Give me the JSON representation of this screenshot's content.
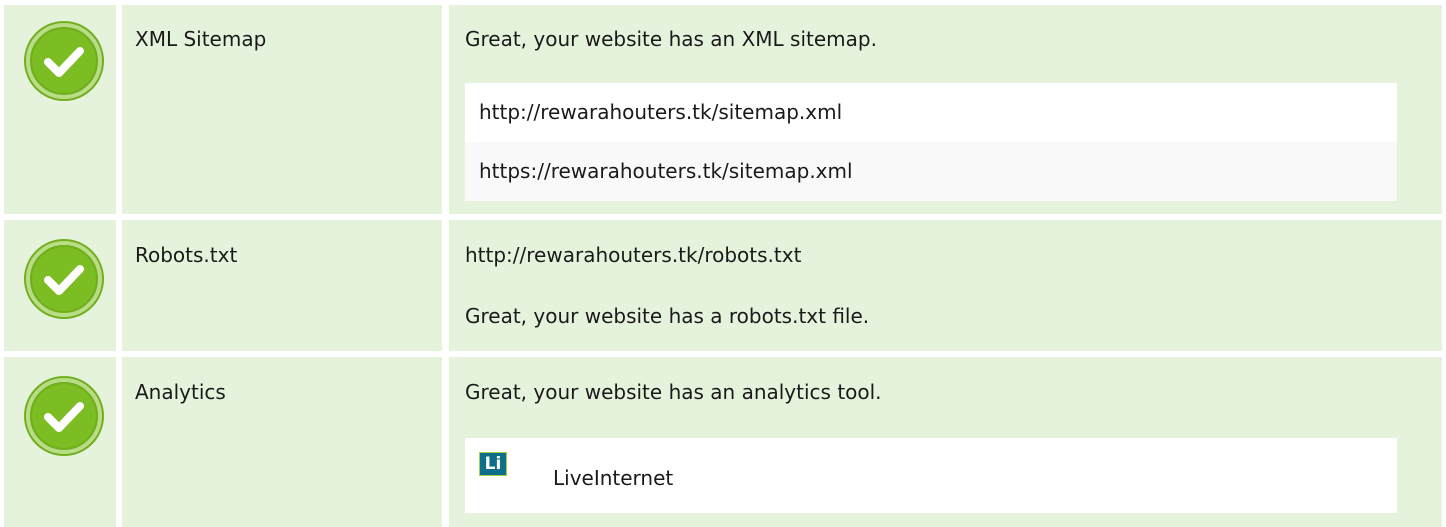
{
  "rows": [
    {
      "label": "XML Sitemap",
      "status": "check-icon",
      "message": "Great, your website has an XML sitemap.",
      "items": [
        "http://rewarahouters.tk/sitemap.xml",
        "https://rewarahouters.tk/sitemap.xml"
      ]
    },
    {
      "label": "Robots.txt",
      "status": "check-icon",
      "url": "http://rewarahouters.tk/robots.txt",
      "message": "Great, your website has a robots.txt file."
    },
    {
      "label": "Analytics",
      "status": "check-icon",
      "message": "Great, your website has an analytics tool.",
      "tool": {
        "logo_text": "Li",
        "name": "LiveInternet"
      }
    }
  ],
  "colors": {
    "row_background": "#e5f3dc",
    "check_green": "#6fae1c",
    "box_background": "#ffffff",
    "box_alt_background": "#f9f9f9"
  }
}
